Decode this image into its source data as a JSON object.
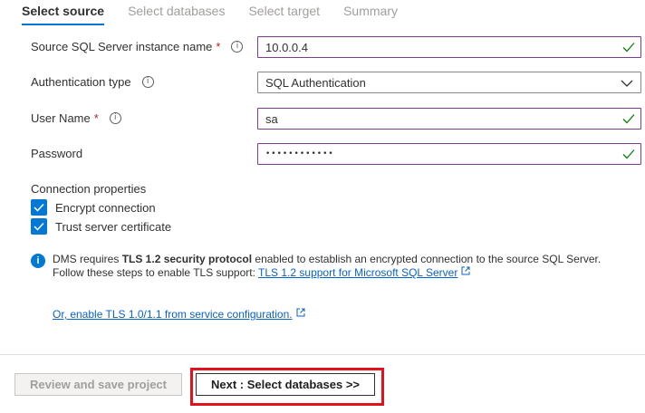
{
  "tabs": [
    "Select source",
    "Select databases",
    "Select target",
    "Summary"
  ],
  "fields": {
    "server": {
      "label": "Source SQL Server instance name",
      "required": "*",
      "value": "10.0.0.4"
    },
    "auth": {
      "label": "Authentication type",
      "value": "SQL Authentication"
    },
    "user": {
      "label": "User Name",
      "required": "*",
      "value": "sa"
    },
    "password": {
      "label": "Password",
      "value": "••••••••••••"
    }
  },
  "connection": {
    "title": "Connection properties",
    "encrypt": "Encrypt connection",
    "trust": "Trust server certificate"
  },
  "notice": {
    "line1_pre": "DMS requires ",
    "line1_bold": "TLS 1.2 security protocol",
    "line1_post": " enabled to establish an encrypted connection to the source SQL Server.",
    "line2_pre": "Follow these steps to enable TLS support: ",
    "line2_link": "TLS 1.2 support for Microsoft SQL Server"
  },
  "config_link": "Or, enable TLS 1.0/1.1 from service configuration.",
  "buttons": {
    "review": "Review and save project",
    "next": "Next : Select databases >>"
  },
  "colors": {
    "accent": "#0078d4",
    "highlight": "#e0121b",
    "valid": "#107c10",
    "required": "#a4262c"
  }
}
